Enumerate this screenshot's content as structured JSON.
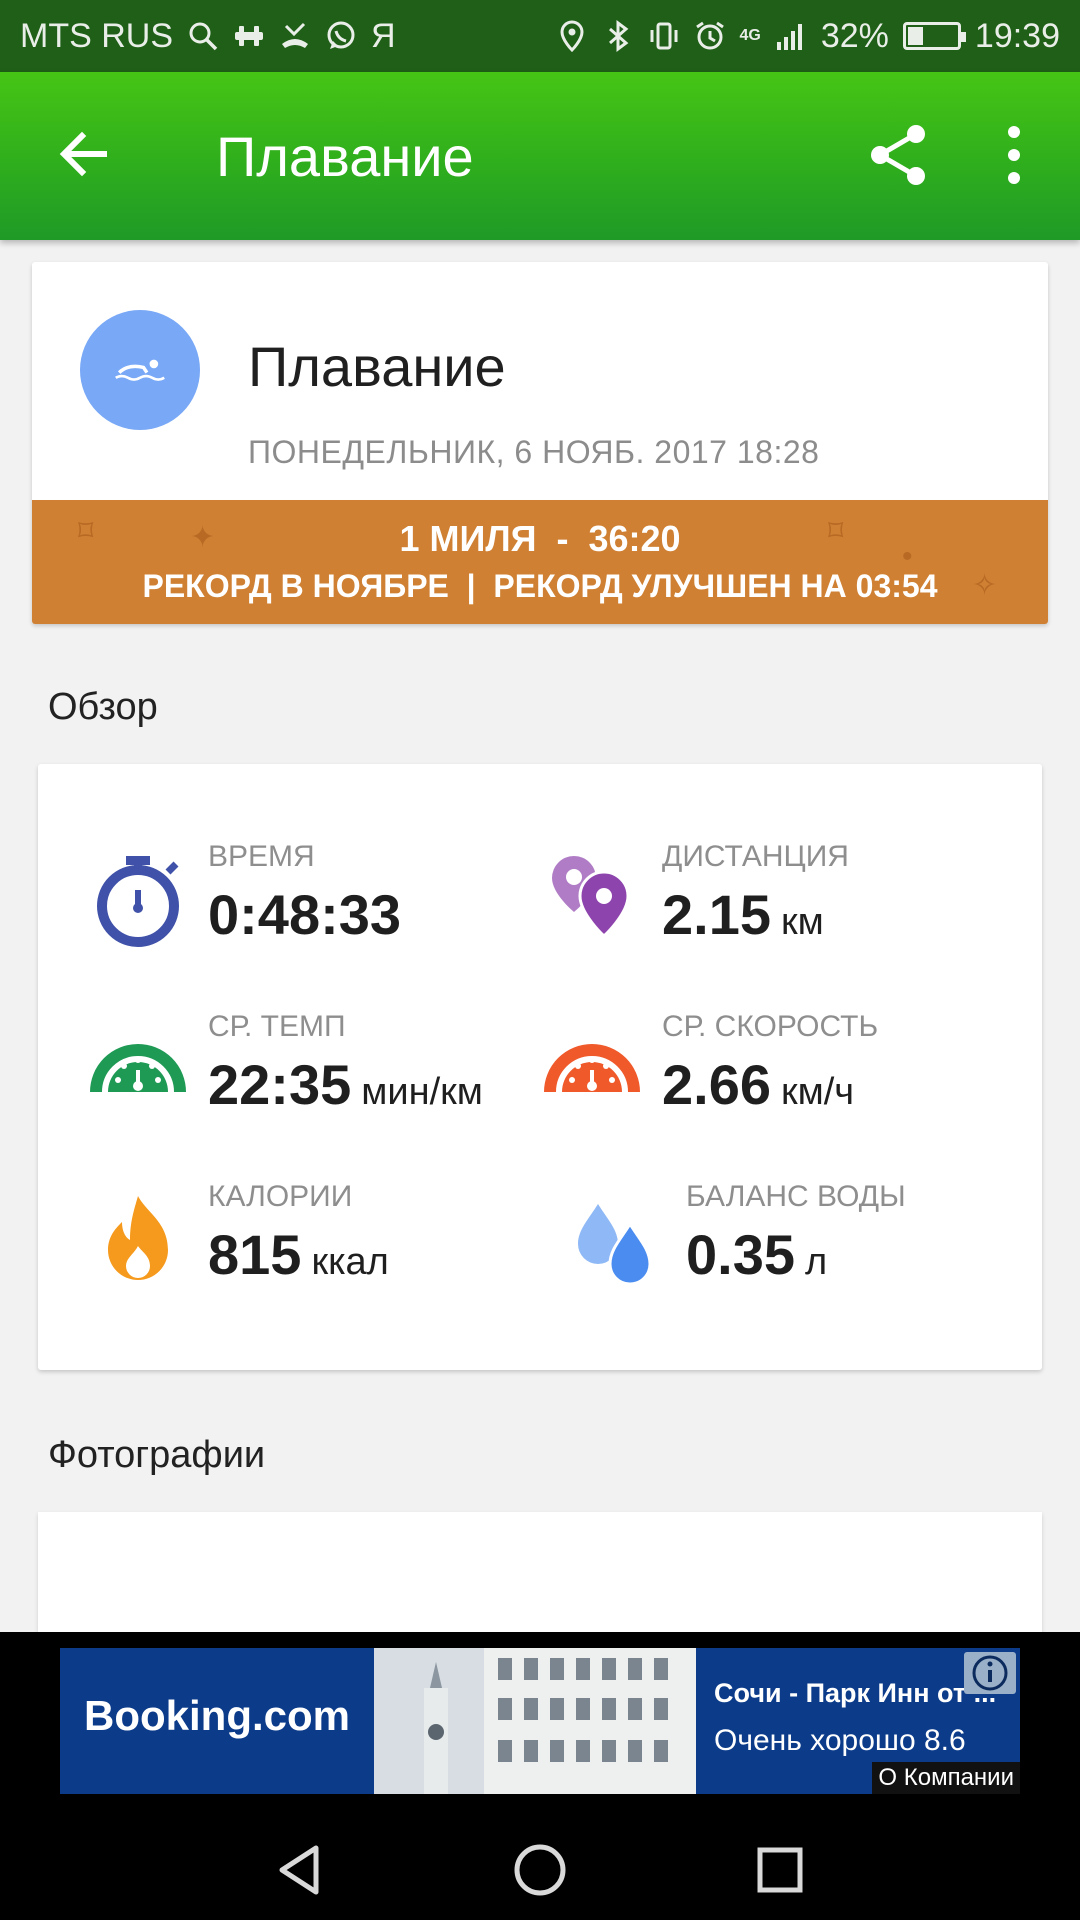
{
  "status_bar": {
    "carrier": "MTS RUS",
    "ya_label": "Я",
    "network": "4G",
    "battery_percent": "32%",
    "battery_level": 0.32,
    "time": "19:39"
  },
  "toolbar": {
    "title": "Плавание"
  },
  "activity": {
    "title": "Плавание",
    "date": "ПОНЕДЕЛЬНИК, 6 НОЯБ. 2017 18:28",
    "record_line1": "1 МИЛЯ  -  36:20",
    "record_line2": "РЕКОРД В НОЯБРЕ  |  РЕКОРД УЛУЧШЕН НА 03:54"
  },
  "overview": {
    "title": "Обзор",
    "metrics": [
      {
        "label": "ВРЕМЯ",
        "value": "0:48:33",
        "unit": "",
        "icon": "stopwatch-icon"
      },
      {
        "label": "ДИСТАНЦИЯ",
        "value": "2.15",
        "unit": "км",
        "icon": "location-pins-icon"
      },
      {
        "label": "СР. ТЕМП",
        "value": "22:35",
        "unit": "мин/км",
        "icon": "pace-gauge-icon"
      },
      {
        "label": "СР. СКОРОСТЬ",
        "value": "2.66",
        "unit": "км/ч",
        "icon": "speed-gauge-icon"
      },
      {
        "label": "КАЛОРИИ",
        "value": "815",
        "unit": "ккал",
        "icon": "fire-icon"
      },
      {
        "label": "БАЛАНС ВОДЫ",
        "value": "0.35",
        "unit": "л",
        "icon": "water-drops-icon"
      }
    ]
  },
  "photos": {
    "title": "Фотографии"
  },
  "ad": {
    "brand": "Booking.com",
    "headline": "Сочи - Парк Инн от ...",
    "rating": "Очень хорошо 8.6",
    "company_link": "О Компании"
  },
  "colors": {
    "toolbar_green": "#2fae1d",
    "status_green": "#1f5f17",
    "record_orange": "#cf8033",
    "avatar_blue": "#78a8f6",
    "time_blue": "#3f51a8",
    "distance_purple": "#8e44ad",
    "pace_green": "#1e9a55",
    "speed_orange": "#f0592a",
    "calorie_orange": "#f59a1c",
    "water_blue": "#4a8cf0"
  }
}
